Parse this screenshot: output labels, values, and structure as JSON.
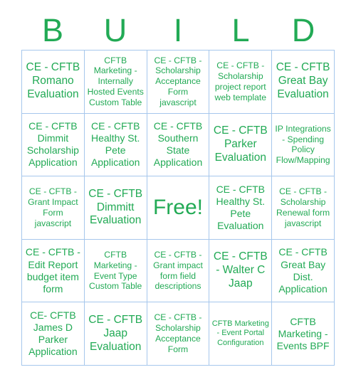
{
  "card": {
    "title_letters": [
      "B",
      "U",
      "I",
      "L",
      "D"
    ],
    "accent_color": "#22aa55",
    "border_color": "#a6c7ec",
    "background_color": "#ffffff",
    "columns": 5,
    "rows": 5,
    "free_space_label": "Free!",
    "free_space_index": 12,
    "cells": [
      {
        "text": "CE - CFTB Romano Evaluation",
        "size": "lg"
      },
      {
        "text": "CFTB Marketing - Internally Hosted Events Custom Table",
        "size": "sm"
      },
      {
        "text": "CE - CFTB - Scholarship Acceptance Form javascript",
        "size": "sm"
      },
      {
        "text": "CE - CFTB - Scholarship project report web template",
        "size": "sm"
      },
      {
        "text": "CE - CFTB Great Bay Evaluation",
        "size": "lg"
      },
      {
        "text": "CE - CFTB Dimmit Scholarship Application",
        "size": "md"
      },
      {
        "text": "CE - CFTB Healthy St. Pete Application",
        "size": "md"
      },
      {
        "text": "CE - CFTB Southern State Application",
        "size": "md"
      },
      {
        "text": "CE - CFTB Parker Evaluation",
        "size": "lg"
      },
      {
        "text": "IP Integrations - Spending Policy Flow/Mapping",
        "size": "sm"
      },
      {
        "text": "CE - CFTB - Grant Impact Form javascript",
        "size": "sm"
      },
      {
        "text": "CE - CFTB Dimmitt Evaluation",
        "size": "lg"
      },
      {
        "text": "Free!",
        "size": "free"
      },
      {
        "text": "CE - CFTB Healthy St. Pete Evaluation",
        "size": "md"
      },
      {
        "text": "CE - CFTB - Scholarship Renewal form javascript",
        "size": "sm"
      },
      {
        "text": "CE - CFTB -Edit Report budget item form",
        "size": "md"
      },
      {
        "text": "CFTB Marketing - Event Type Custom Table",
        "size": "sm"
      },
      {
        "text": "CE - CFTB - Grant impact form field descriptions",
        "size": "sm"
      },
      {
        "text": "CE - CFTB - Walter C Jaap",
        "size": "lg"
      },
      {
        "text": "CE - CFTB Great Bay Dist. Application",
        "size": "md"
      },
      {
        "text": "CE- CFTB James D Parker Application",
        "size": "md"
      },
      {
        "text": "CE - CFTB Jaap Evaluation",
        "size": "lg"
      },
      {
        "text": "CE - CFTB - Scholarship Acceptance Form",
        "size": "sm"
      },
      {
        "text": "CFTB Marketing - Event Portal Configuration",
        "size": "xs"
      },
      {
        "text": "CFTB Marketing - Events BPF",
        "size": "md"
      }
    ]
  }
}
